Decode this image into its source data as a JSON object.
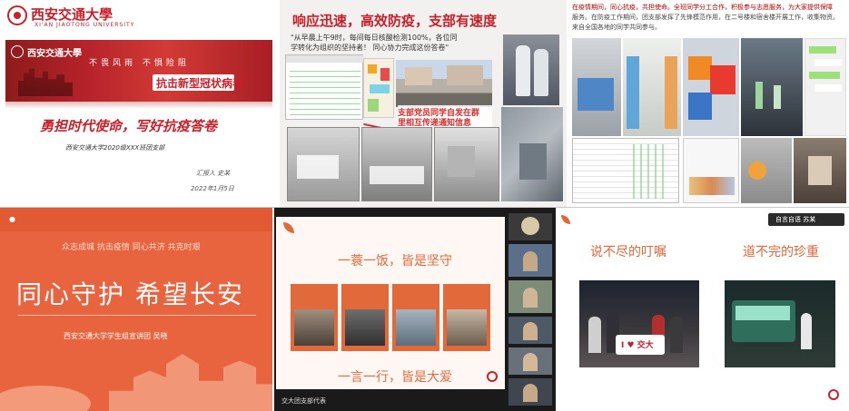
{
  "panel1": {
    "logo_text": "西安交通大學",
    "logo_sub": "XI'AN JIAOTONG UNIVERSITY",
    "banner_logo": "西安交通大學",
    "banner_tagline": "不畏风雨 不惧险阻",
    "banner_title": "抗击新型冠状病毒",
    "headline": "勇担时代使命，写好抗疫答卷",
    "subline": "西安交通大学2020级XXX班团支部",
    "presenter": "汇报人  史某",
    "date": "2022年1月5日",
    "colors": {
      "red": "#c8202a",
      "dark_red": "#8e1b1b"
    }
  },
  "panel2": {
    "title": "响应迅速，高效防疫，支部有速度",
    "quote_line1": "\"从早晨上午9时，每间每日核酸检测100%，各位同",
    "quote_line2": "学转化为组织的坚持者！  同心协力完成这份答卷\"",
    "callout_line1": "支部党员同学自发在群",
    "callout_line2": "里相互传递通知信息",
    "colors": {
      "title_red": "#c8202a",
      "callout": "#d42e2e"
    }
  },
  "panel3": {
    "caption_line1": "在疫情期间，同心抗疫，共担使命。全班同学分工合作，积极参与志愿服务，为大家提供保障",
    "caption_line2": "服务。在防疫工作期间，团支部发挥了先锋模范作用，在二号楼和宿舍楼开展工作，收集物资。",
    "caption_line3": "来自全国各地的同学共同参与。"
  },
  "panel4": {
    "tags": "众志成城 抗击疫情  同心共济  共克时艰",
    "title": "同心守护  希望长安",
    "subtitle": "西安交通大学学生组宣讲团  吴晓",
    "colors": {
      "bg": "#e8643f",
      "light": "#f6b193"
    }
  },
  "panel5": {
    "line_top": "一蓑一饭，皆是坚守",
    "line_bottom": "一言一行，皆是大爱",
    "participant_bottom_label": "交大团支部代表",
    "colors": {
      "accent": "#e26a3a",
      "panel_bg": "#fff7f3"
    }
  },
  "panel6": {
    "header_label": "自言自语  苏某",
    "title_left": "说不尽的叮嘱",
    "title_right": "道不完的珍重",
    "sign_text": "I ♥ 交大",
    "colors": {
      "accent": "#e0663a"
    }
  }
}
